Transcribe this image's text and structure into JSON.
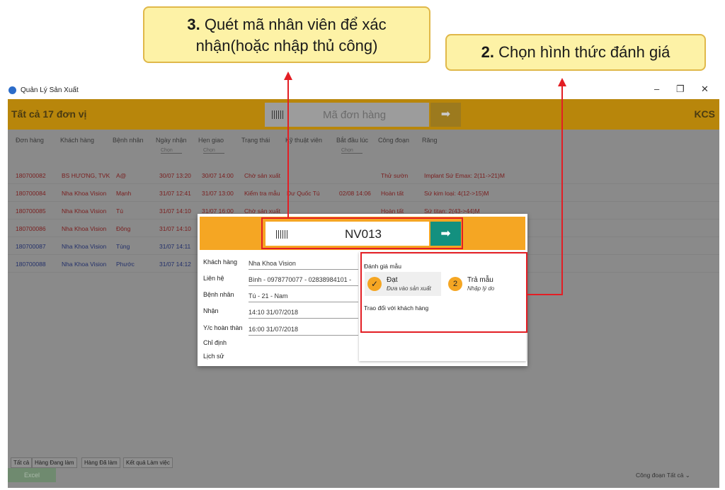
{
  "callouts": {
    "step3_num": "3.",
    "step3_text_1": "Quét mã nhân viên để xác",
    "step3_text_2": "nhận(hoặc nhập thủ công)",
    "step2_num": "2.",
    "step2_text": "Chọn hình thức đánh giá"
  },
  "window": {
    "title": "Quản Lý Sản Xuất",
    "minimize": "–",
    "maximize": "❐",
    "close": "✕"
  },
  "topbar": {
    "count": "Tất cả  17  đơn vị",
    "search_placeholder": "Mã đơn hàng",
    "go_icon": "➡",
    "right_label": "KCS"
  },
  "table": {
    "headers": [
      "Đơn hàng",
      "Khách hàng",
      "Bệnh nhân",
      "Ngày nhận",
      "Hẹn giao",
      "Trạng thái",
      "Kỹ thuật viên",
      "Bắt đầu lúc",
      "Công đoạn",
      "Răng"
    ],
    "filter_placeholder": "Chọn",
    "rows": [
      {
        "order": "180700082",
        "customer": "BS HƯƠNG, TVK",
        "patient": "A@",
        "received": "30/07 13:20",
        "due": "30/07 14:00",
        "status": "Chờ sản xuất",
        "tech": "",
        "start": "",
        "stage": "Thử sườn",
        "teeth": "Implant Sứ Emax: 2(11->21)M",
        "color": "red"
      },
      {
        "order": "180700084",
        "customer": "Nha Khoa Vision",
        "patient": "Mạnh",
        "received": "31/07 12:41",
        "due": "31/07 13:00",
        "status": "Kiểm tra mẫu",
        "tech": "Dư Quốc Tú",
        "start": "02/08 14:06",
        "stage": "Hoàn tất",
        "teeth": "Sứ kim loại: 4(12->15)M",
        "color": "red"
      },
      {
        "order": "180700085",
        "customer": "Nha Khoa Vision",
        "patient": "Tú",
        "received": "31/07 14:10",
        "due": "31/07 16:00",
        "status": "Chờ sản xuất",
        "tech": "",
        "start": "",
        "stage": "Hoàn tất",
        "teeth": "Sứ titan: 2(43->44)M",
        "color": "red"
      },
      {
        "order": "180700086",
        "customer": "Nha Khoa Vision",
        "patient": "Đông",
        "received": "31/07 14:10",
        "due": "",
        "status": "",
        "tech": "",
        "start": "",
        "stage": "",
        "teeth": "",
        "color": "red"
      },
      {
        "order": "180700087",
        "customer": "Nha Khoa Vision",
        "patient": "Tùng",
        "received": "31/07 14:11",
        "due": "",
        "status": "",
        "tech": "",
        "start": "",
        "stage": "",
        "teeth": "",
        "color": "blue"
      },
      {
        "order": "180700088",
        "customer": "Nha Khoa Vision",
        "patient": "Phước",
        "received": "31/07 14:12",
        "due": "",
        "status": "",
        "tech": "",
        "start": "",
        "stage": "",
        "teeth": "",
        "color": "blue"
      }
    ]
  },
  "bottom_tabs": [
    "Tất cả",
    "Hàng Đang làm",
    "Hàng Đã làm",
    "Kết quả Làm việc"
  ],
  "excel_button": "Excel",
  "stage_select": "Công đoạn  Tất cả",
  "stage_select_arrow": "⌄",
  "dialog": {
    "employee_code": "NV013",
    "go_icon": "➡",
    "fields": [
      {
        "label": "Khách hàng",
        "value": "Nha Khoa Vision"
      },
      {
        "label": "Liên hệ",
        "value": "Bình - 0978770077 - 02838984101 -"
      },
      {
        "label": "Bệnh nhân",
        "value": "Tú - 21 - Nam"
      },
      {
        "label": "Nhận",
        "value": "14:10 31/07/2018"
      },
      {
        "label": "Y/c hoàn thàn",
        "value": "16:00 31/07/2018"
      }
    ],
    "static_labels": [
      "Chỉ định",
      "Lịch sử"
    ],
    "eval_title": "Đánh giá mẫu",
    "pass_icon": "✓",
    "pass_label": "Đạt",
    "pass_sub": "Đưa vào sản xuất",
    "return_number": "2",
    "return_label": "Trả mẫu",
    "return_sub": "Nhập lý do",
    "customer_comm": "Trao đổi với khách hàng"
  },
  "colors": {
    "accent_orange": "#f5a623",
    "teal": "#13907f",
    "highlight_red": "#e31e24",
    "callout_yellow": "#fdf2a6"
  }
}
